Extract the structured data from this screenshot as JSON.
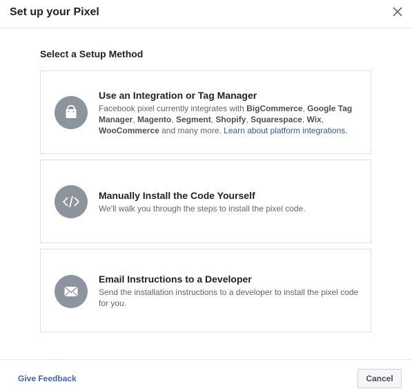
{
  "dialog": {
    "title": "Set up your Pixel",
    "subtitle": "Select a Setup Method"
  },
  "options": [
    {
      "icon": "shopping-bag-icon",
      "title": "Use an Integration or Tag Manager",
      "desc_prefix": "Facebook pixel currently integrates with ",
      "platforms": [
        "BigCommerce",
        "Google Tag Manager",
        "Magento",
        "Segment",
        "Shopify",
        "Squarespace",
        "Wix",
        "WooCommerce"
      ],
      "desc_suffix": " and many more. ",
      "link": "Learn about platform integrations."
    },
    {
      "icon": "code-icon",
      "title": "Manually Install the Code Yourself",
      "desc": "We'll walk you through the steps to install the pixel code."
    },
    {
      "icon": "envelope-icon",
      "title": "Email Instructions to a Developer",
      "desc": "Send the installation instructions to a developer to install the pixel code for you."
    }
  ],
  "footer": {
    "feedback_label": "Give Feedback",
    "cancel_label": "Cancel"
  },
  "colors": {
    "icon_circle": "#8d949e",
    "link": "#385898",
    "feedback": "#4267b2"
  }
}
